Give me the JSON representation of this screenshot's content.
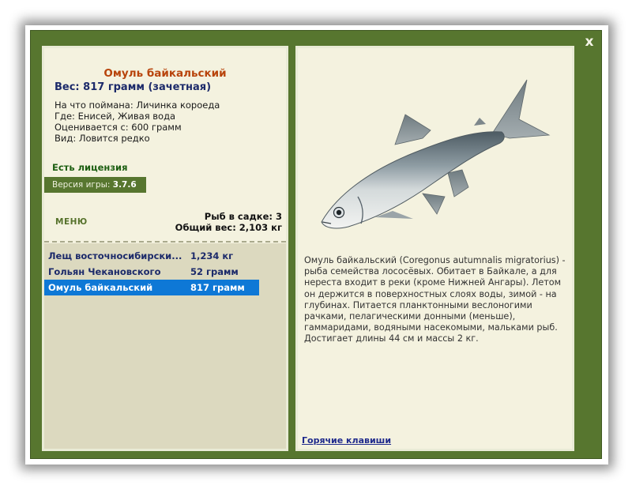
{
  "window": {
    "close_label": "x"
  },
  "catch": {
    "title": "Омуль байкальский",
    "weight_line": "Вес: 817 грамм (зачетная)",
    "caught_on": "На что поймана: Личинка короеда",
    "location": "Где: Енисей, Живая вода",
    "valued_from": "Оценивается с: 600 грамм",
    "kind": "Вид: Ловится редко"
  },
  "license_label": "Есть лицензия",
  "version": {
    "label": "Версия игры:",
    "value": "3.7.6"
  },
  "menu_label": "МЕНЮ",
  "keepnet": {
    "count_line": "Рыб в садке: 3",
    "total_line": "Общий вес: 2,103 кг",
    "fish": [
      {
        "name": "Лещ восточносибирски...",
        "weight": "1,234 кг",
        "selected": false
      },
      {
        "name": "Гольян Чекановского",
        "weight": "52 грамм",
        "selected": false
      },
      {
        "name": "Омуль байкальский",
        "weight": "817 грамм",
        "selected": true
      }
    ]
  },
  "description": "Омуль байкальский (Coregonus autumnalis migratorius) - рыба семейства лососёвых. Обитает в Байкале, а для нереста входит в реки (кроме Нижней Ангары). Летом он держится в поверхностных слоях воды, зимой - на глубинах. Питается планктонными веслоногими рачками, пелагическими донными (меньше), гаммаридами, водяными насекомыми, мальками рыб. Достигает длины 44 см и массы 2 кг.",
  "hotkeys_label": "Горячие клавиши",
  "colors": {
    "frame": "#57762f",
    "panel": "#f4f2df",
    "list_bg": "#dcd9bf",
    "selected_row": "#0e78d6",
    "title": "#b8440c",
    "dark_blue": "#1c2a6a"
  },
  "icons": {
    "fish_image": "omul-fish-illustration",
    "close": "close-icon"
  }
}
